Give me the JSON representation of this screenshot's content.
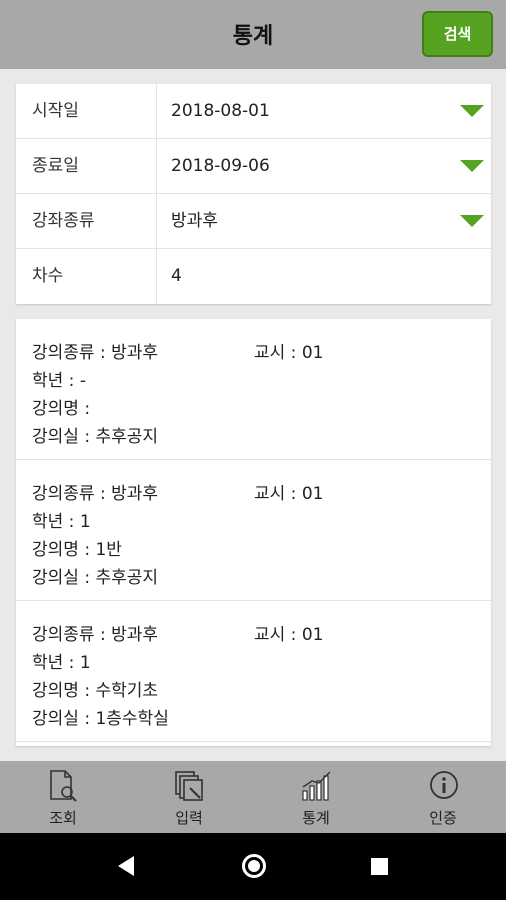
{
  "header": {
    "title": "통계",
    "search_label": "검색"
  },
  "form": {
    "rows": [
      {
        "label": "시작일",
        "value": "2018-08-01",
        "dropdown": true
      },
      {
        "label": "종료일",
        "value": "2018-09-06",
        "dropdown": true
      },
      {
        "label": "강좌종류",
        "value": "방과후",
        "dropdown": true
      },
      {
        "label": "차수",
        "value": "4",
        "dropdown": false
      }
    ]
  },
  "records": [
    {
      "type": "강의종류 : 방과후",
      "period": "교시 : 01",
      "grade": "학년 : -",
      "name": "강의명 :",
      "room": "강의실 : 추후공지"
    },
    {
      "type": "강의종류 : 방과후",
      "period": "교시 : 01",
      "grade": "학년 : 1",
      "name": "강의명 : 1반",
      "room": "강의실 : 추후공지"
    },
    {
      "type": "강의종류 : 방과후",
      "period": "교시 : 01",
      "grade": "학년 : 1",
      "name": "강의명 : 수학기초",
      "room": "강의실 : 1층수학실"
    }
  ],
  "nav": {
    "items": [
      {
        "label": "조회",
        "icon": "document-search-icon"
      },
      {
        "label": "입력",
        "icon": "edit-pages-icon"
      },
      {
        "label": "통계",
        "icon": "chart-icon"
      },
      {
        "label": "인증",
        "icon": "info-icon"
      }
    ]
  },
  "colors": {
    "accent": "#55a321",
    "bar": "#a8a8a8"
  }
}
